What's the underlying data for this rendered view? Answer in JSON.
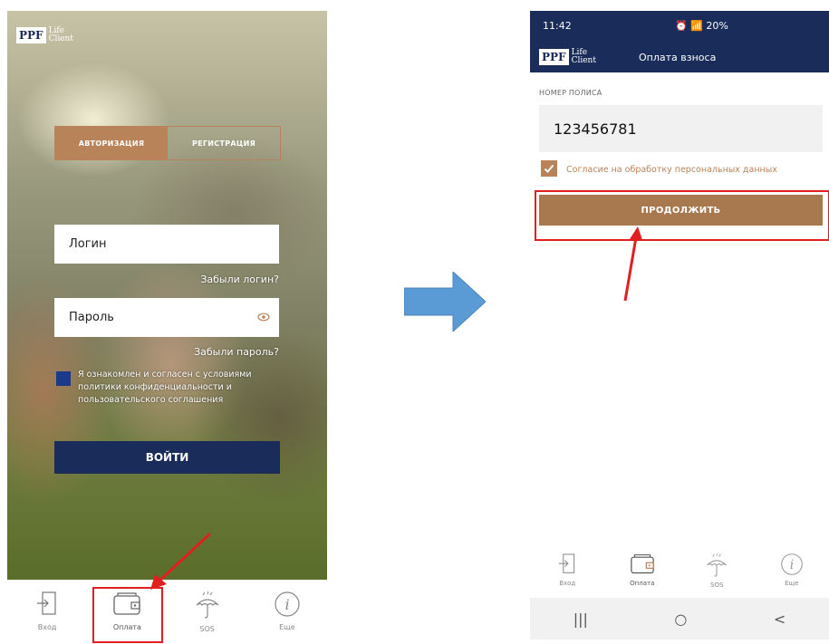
{
  "left_screen": {
    "brand": {
      "ppf": "PPF",
      "life_client": "Life\nClient"
    },
    "tabs": [
      {
        "label": "АВТОРИЗАЦИЯ",
        "active": true
      },
      {
        "label": "РЕГИСТРАЦИЯ",
        "active": false
      }
    ],
    "login": {
      "placeholder": "Логин",
      "forgot": "Забыли логин?"
    },
    "password": {
      "placeholder": "Пароль",
      "forgot": "Забыли пароль?"
    },
    "consent": {
      "text_prefix": "Я ознакомлен и согласен с условиями ",
      "link_policy": "политики конфиденциальности",
      "text_mid": " и ",
      "link_terms": "пользовательского соглашения"
    },
    "login_button": "ВОЙТИ",
    "nav": [
      {
        "label": "Вход",
        "icon": "login-icon"
      },
      {
        "label": "Оплата",
        "icon": "wallet-icon",
        "active": true
      },
      {
        "label": "SOS",
        "icon": "umbrella-icon"
      },
      {
        "label": "Еще",
        "icon": "info-icon"
      }
    ]
  },
  "right_screen": {
    "status": {
      "time": "11:42",
      "battery": "20%"
    },
    "header": {
      "ppf": "PPF",
      "life_client": "Life\nClient",
      "title": "Оплата взноса"
    },
    "policy": {
      "label": "НОМЕР ПОЛИСА",
      "value": "123456781"
    },
    "consent": {
      "checked": true,
      "label": "Согласие на обработку персональных данных"
    },
    "continue_button": "ПРОДОЛЖИТЬ",
    "nav": [
      {
        "label": "Вход",
        "icon": "login-icon"
      },
      {
        "label": "Оплата",
        "icon": "wallet-icon",
        "active": true
      },
      {
        "label": "SOS",
        "icon": "umbrella-icon"
      },
      {
        "label": "Еще",
        "icon": "info-icon"
      }
    ],
    "android_nav": {
      "recent": "|||",
      "home": "○",
      "back": "<"
    }
  },
  "colors": {
    "navy": "#1a2d5a",
    "copper": "#b9835a",
    "highlight_red": "#e02020",
    "arrow_blue": "#5b9bd5"
  }
}
